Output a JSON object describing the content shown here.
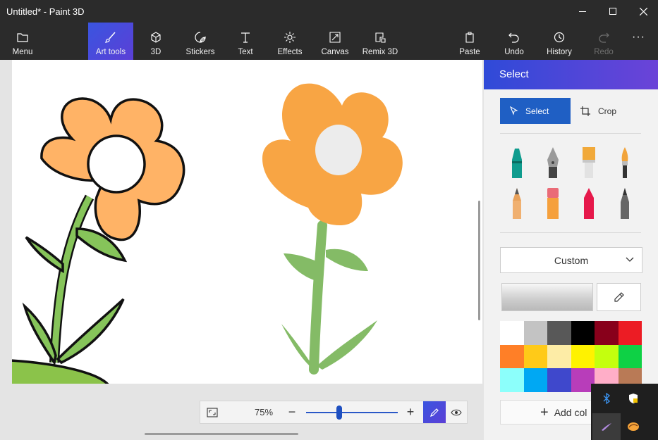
{
  "window": {
    "title": "Untitled* - Paint 3D",
    "minimize_icon": "minimize-icon",
    "maximize_icon": "maximize-icon",
    "close_icon": "close-icon"
  },
  "toolbar": {
    "items": [
      {
        "label": "Menu",
        "icon": "folder-icon"
      },
      {
        "label": "Art tools",
        "icon": "brush-icon",
        "active": true
      },
      {
        "label": "3D",
        "icon": "cube-icon"
      },
      {
        "label": "Stickers",
        "icon": "sticker-icon"
      },
      {
        "label": "Text",
        "icon": "text-icon"
      },
      {
        "label": "Effects",
        "icon": "sun-icon"
      },
      {
        "label": "Canvas",
        "icon": "canvas-resize-icon"
      },
      {
        "label": "Remix 3D",
        "icon": "remix-icon"
      },
      {
        "label": "Paste",
        "icon": "clipboard-icon"
      },
      {
        "label": "Undo",
        "icon": "undo-icon"
      },
      {
        "label": "History",
        "icon": "history-icon"
      },
      {
        "label": "Redo",
        "icon": "redo-icon",
        "disabled": true
      }
    ],
    "more_icon": "more-icon"
  },
  "zoom": {
    "percent": "75%",
    "minus": "−",
    "plus": "+",
    "level": 0.36
  },
  "panel": {
    "title": "Select",
    "select_label": "Select",
    "crop_label": "Crop",
    "dropdown_value": "Custom",
    "add_color_label": "Add col",
    "brushes": [
      "marker",
      "calligraphy-pen",
      "oil-brush",
      "watercolor",
      "pencil",
      "eraser",
      "crayon",
      "pixel-pen"
    ],
    "palette": [
      "#ffffff",
      "#c3c3c3",
      "#585858",
      "#000000",
      "#88001b",
      "#ec1c24",
      "#ff7f27",
      "#ffca18",
      "#fdeca6",
      "#fff200",
      "#c4ff0e",
      "#0ed145",
      "#8cfffb",
      "#00a8f3",
      "#3f48cc",
      "#b83dba",
      "#ffaec8",
      "#b97a56"
    ]
  },
  "tray": {
    "icons": [
      "bluetooth-icon",
      "security-icon",
      "pen-icon",
      "paint-icon"
    ]
  }
}
